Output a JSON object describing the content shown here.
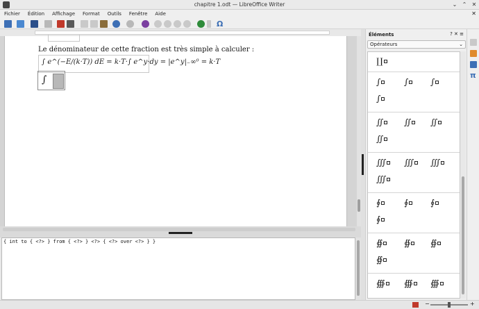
{
  "window": {
    "title": "chapitre 1.odt — LibreOffice Writer"
  },
  "menu": [
    "Fichier",
    "Édition",
    "Affichage",
    "Format",
    "Outils",
    "Fenêtre",
    "Aide"
  ],
  "document": {
    "paragraph": "Le dénominateur de cette fraction est très simple à calculer :",
    "formula1": "∫ e^(−E/(k·T)) dE = k·T·∫ e^y·dy = |e^y|₋∞⁰ = k·T"
  },
  "command_editor": {
    "text": "{ int to { <?> } from { <?> } <?> { <?> over <?> } }"
  },
  "sidebar": {
    "title": "Éléments",
    "header_buttons": "? ✕ ≡",
    "category": "Opérateurs",
    "elements": [
      {
        "symbol": "∐",
        "name": "coproduct-icon"
      },
      {
        "symbol": "∫",
        "name": "integral-icon"
      },
      {
        "symbol": "∫",
        "name": "integral-upper-icon"
      },
      {
        "symbol": "∫",
        "name": "integral-lower-icon"
      },
      {
        "symbol": "∫",
        "name": "integral-from-to-icon"
      },
      {
        "symbol": "∬",
        "name": "double-integral-icon"
      },
      {
        "symbol": "∬",
        "name": "double-integral-upper-icon"
      },
      {
        "symbol": "∬",
        "name": "double-integral-lower-icon"
      },
      {
        "symbol": "∬",
        "name": "double-integral-from-to-icon"
      },
      {
        "symbol": "∭",
        "name": "triple-integral-icon"
      },
      {
        "symbol": "∭",
        "name": "triple-integral-upper-icon"
      },
      {
        "symbol": "∭",
        "name": "triple-integral-lower-icon"
      },
      {
        "symbol": "∭",
        "name": "triple-integral-from-to-icon"
      },
      {
        "symbol": "∮",
        "name": "contour-integral-icon"
      },
      {
        "symbol": "∮",
        "name": "contour-integral-upper-icon"
      },
      {
        "symbol": "∮",
        "name": "contour-integral-lower-icon"
      },
      {
        "symbol": "∮",
        "name": "contour-integral-from-to-icon"
      },
      {
        "symbol": "∯",
        "name": "surface-integral-icon"
      },
      {
        "symbol": "∯",
        "name": "surface-integral-upper-icon"
      },
      {
        "symbol": "∯",
        "name": "surface-integral-lower-icon"
      },
      {
        "symbol": "∯",
        "name": "surface-integral-from-to-icon"
      },
      {
        "symbol": "∰",
        "name": "volume-integral-icon"
      },
      {
        "symbol": "∰",
        "name": "volume-integral-upper-icon"
      },
      {
        "symbol": "∰",
        "name": "volume-integral-lower-icon"
      }
    ]
  },
  "toolbar_icons": [
    "new-icon",
    "open-icon",
    "save-icon",
    "email-icon",
    "pdf-icon",
    "print-icon",
    "cut-icon",
    "copy-icon",
    "paste-icon",
    "undo-icon",
    "redo-icon",
    "help-icon",
    "zoom-in-icon",
    "zoom-out-icon",
    "zoom-100-icon",
    "zoom-fit-icon",
    "refresh-icon",
    "cursor-icon",
    "special-char-icon"
  ],
  "colors": {
    "accent": "#3d6fb5",
    "red": "#c0392b",
    "green": "#2e8b3a"
  }
}
